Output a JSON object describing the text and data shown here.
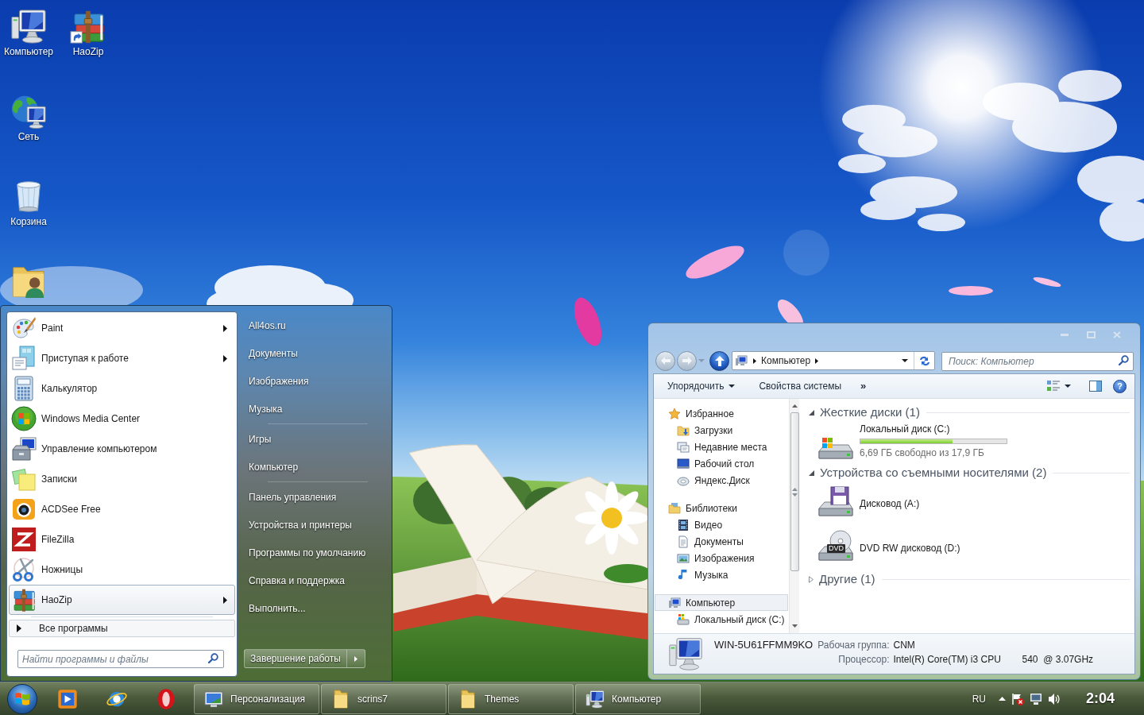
{
  "desktop": {
    "icon_columns": [
      [
        {
          "kind": "computer",
          "label": "Компьютер"
        },
        {
          "kind": "network",
          "label": "Сеть"
        },
        {
          "kind": "recycle-bin",
          "label": "Корзина"
        },
        {
          "kind": "user-folder"
        }
      ],
      [
        {
          "kind": "archiver-shortcut",
          "label": "HaoZip"
        }
      ]
    ]
  },
  "start_menu": {
    "programs": [
      {
        "kind": "paint",
        "label": "Paint",
        "has_submenu": true,
        "selected": false
      },
      {
        "kind": "getting-started",
        "label": "Приступая к работе",
        "has_submenu": true,
        "selected": false
      },
      {
        "kind": "calculator",
        "label": "Калькулятор",
        "has_submenu": false,
        "selected": false
      },
      {
        "kind": "media-center",
        "label": "Windows Media Center",
        "has_submenu": false,
        "selected": false
      },
      {
        "kind": "computer-management",
        "label": "Управление компьютером",
        "has_submenu": false,
        "selected": false
      },
      {
        "kind": "sticky-notes",
        "label": "Записки",
        "has_submenu": false,
        "selected": false
      },
      {
        "kind": "photo-viewer",
        "label": "ACDSee Free",
        "has_submenu": false,
        "selected": false
      },
      {
        "kind": "ftp-client",
        "label": "FileZilla",
        "has_submenu": false,
        "selected": false
      },
      {
        "kind": "scissors",
        "label": "Ножницы",
        "has_submenu": false,
        "selected": false
      },
      {
        "kind": "archiver",
        "label": "HaoZip",
        "has_submenu": true,
        "selected": true
      }
    ],
    "all_programs": "Все программы",
    "search": {
      "placeholder": "Найти программы и файлы"
    },
    "place_groups": [
      [
        "All4os.ru",
        "Документы",
        "Изображения",
        "Музыка"
      ],
      [
        "Игры",
        "Компьютер"
      ],
      [
        "Панель управления",
        "Устройства и принтеры",
        "Программы по умолчанию",
        "Справка и поддержка",
        "Выполнить..."
      ]
    ],
    "shutdown": {
      "label": "Завершение работы"
    }
  },
  "explorer": {
    "address": {
      "crumbs": [
        "Компьютер"
      ]
    },
    "search": {
      "placeholder": "Поиск: Компьютер"
    },
    "toolbar": [
      {
        "kind": "menu",
        "label": "Упорядочить"
      },
      {
        "kind": "command",
        "label": "Свойства системы"
      },
      {
        "kind": "overflow",
        "label": "»"
      }
    ],
    "help_button": {
      "label": "?"
    },
    "nav": [
      {
        "kind": "favorites",
        "label": "Избранное",
        "selected": false,
        "children": [
          {
            "kind": "downloads",
            "label": "Загрузки",
            "selected": false
          },
          {
            "kind": "recent",
            "label": "Недавние места",
            "selected": false
          },
          {
            "kind": "desktop",
            "label": "Рабочий стол",
            "selected": false
          },
          {
            "kind": "cloud-disk",
            "label": "Яндекс.Диск",
            "selected": false
          }
        ]
      },
      {
        "kind": "libraries",
        "label": "Библиотеки",
        "selected": false,
        "children": [
          {
            "kind": "video",
            "label": "Видео",
            "selected": false
          },
          {
            "kind": "documents",
            "label": "Документы",
            "selected": false
          },
          {
            "kind": "pictures",
            "label": "Изображения",
            "selected": false
          },
          {
            "kind": "music",
            "label": "Музыка",
            "selected": false
          }
        ]
      },
      {
        "kind": "computer",
        "label": "Компьютер",
        "selected": true,
        "children": [
          {
            "kind": "drive",
            "label": "Локальный диск (C:)",
            "selected": false
          }
        ]
      }
    ],
    "groups": [
      {
        "title": "Жесткие диски (1)",
        "expanded": true,
        "items": [
          {
            "kind": "hdd",
            "name": "Локальный диск (C:)",
            "level": 0.63,
            "space": "6,69 ГБ свободно из 17,9 ГБ"
          }
        ]
      },
      {
        "title": "Устройства со съемными носителями (2)",
        "expanded": true,
        "items": [
          {
            "kind": "floppy",
            "name": "Дисковод (A:)"
          },
          {
            "kind": "dvd",
            "name": "DVD RW дисковод (D:)",
            "icon_label": "DVD"
          }
        ]
      },
      {
        "title": "Другие (1)",
        "expanded": false
      }
    ],
    "details": {
      "computer_name": "WIN-5U61FFMM9KO",
      "fields": [
        {
          "label": "Рабочая группа:",
          "value": "CNM"
        },
        {
          "label": "Процессор:",
          "value": "Intel(R) Core(TM) i3 CPU        540  @ 3.07GHz"
        }
      ]
    }
  },
  "taskbar": {
    "pinned": [
      {
        "kind": "media-player"
      },
      {
        "kind": "browser-e"
      },
      {
        "kind": "browser-o"
      }
    ],
    "tasks": [
      {
        "kind": "personalization",
        "label": "Персонализация"
      },
      {
        "kind": "folder",
        "label": "scrins7"
      },
      {
        "kind": "folder",
        "label": "Themes"
      },
      {
        "kind": "computer",
        "label": "Компьютер"
      }
    ],
    "tray": {
      "language": "RU",
      "icons": [
        {
          "kind": "show-hidden"
        },
        {
          "kind": "action-center-alert"
        },
        {
          "kind": "network"
        },
        {
          "kind": "volume"
        }
      ]
    },
    "clock": "2:04"
  }
}
